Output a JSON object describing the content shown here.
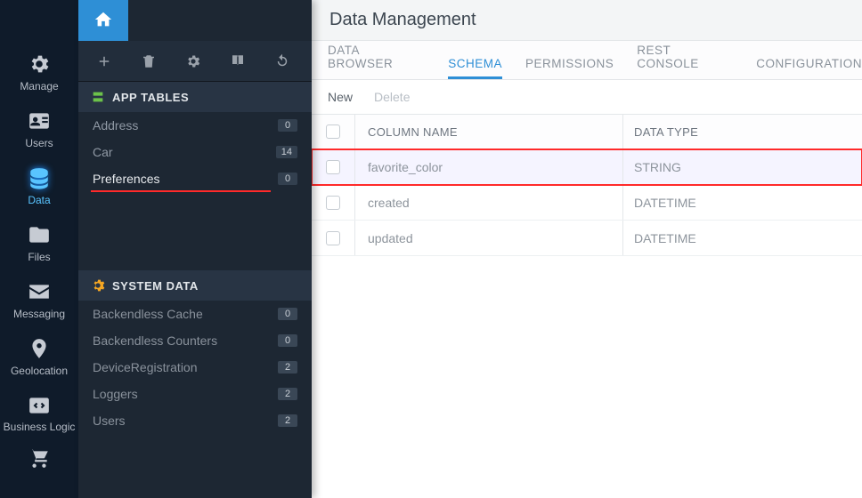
{
  "rail": {
    "items": [
      {
        "label": "Manage"
      },
      {
        "label": "Users"
      },
      {
        "label": "Data"
      },
      {
        "label": "Files"
      },
      {
        "label": "Messaging"
      },
      {
        "label": "Geolocation"
      },
      {
        "label": "Business Logic"
      }
    ]
  },
  "page_title": "Data Management",
  "app_tables_heading": "APP TABLES",
  "system_data_heading": "SYSTEM DATA",
  "app_tables": [
    {
      "name": "Address",
      "count": "0"
    },
    {
      "name": "Car",
      "count": "14"
    },
    {
      "name": "Preferences",
      "count": "0"
    }
  ],
  "system_tables": [
    {
      "name": "Backendless Cache",
      "count": "0"
    },
    {
      "name": "Backendless Counters",
      "count": "0"
    },
    {
      "name": "DeviceRegistration",
      "count": "2"
    },
    {
      "name": "Loggers",
      "count": "2"
    },
    {
      "name": "Users",
      "count": "2"
    }
  ],
  "tabs": [
    {
      "label": "DATA BROWSER"
    },
    {
      "label": "SCHEMA"
    },
    {
      "label": "PERMISSIONS"
    },
    {
      "label": "REST CONSOLE"
    },
    {
      "label": "CONFIGURATION"
    }
  ],
  "actions": {
    "new_label": "New",
    "delete_label": "Delete"
  },
  "grid": {
    "col_name_header": "COLUMN NAME",
    "col_type_header": "DATA TYPE",
    "rows": [
      {
        "name": "favorite_color",
        "type": "STRING"
      },
      {
        "name": "created",
        "type": "DATETIME"
      },
      {
        "name": "updated",
        "type": "DATETIME"
      }
    ]
  }
}
